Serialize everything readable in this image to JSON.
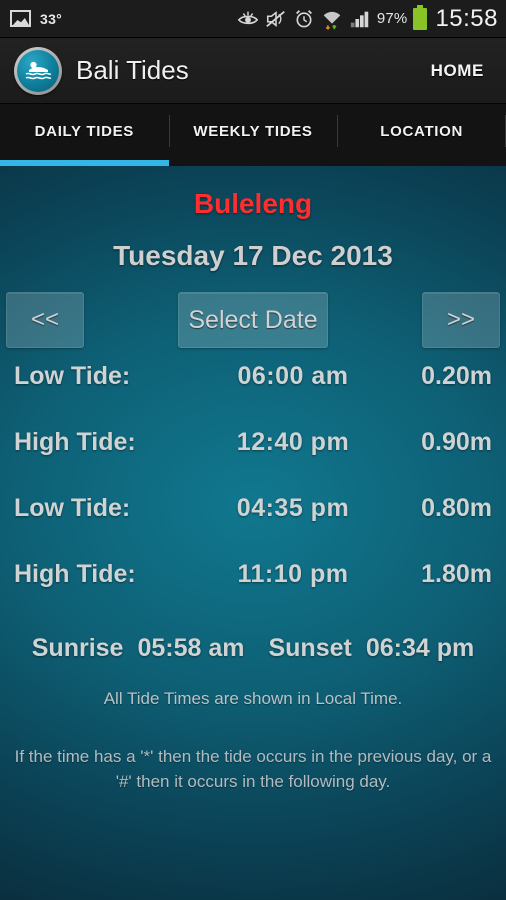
{
  "status_bar": {
    "gallery_icon": "gallery-icon",
    "temperature": "33°",
    "eye_icon": "eye-icon",
    "mute_icon": "mute-icon",
    "alarm_icon": "alarm-icon",
    "wifi_icon": "wifi-icon",
    "signal_icon": "signal-icon",
    "battery_percent": "97%",
    "battery_icon": "battery-icon",
    "clock": "15:58",
    "battery_color": "#8ac326"
  },
  "action_bar": {
    "logo_icon": "swimmer-logo-icon",
    "title": "Bali Tides",
    "home_label": "HOME"
  },
  "tabs": [
    {
      "label": "DAILY TIDES",
      "selected": true
    },
    {
      "label": "WEEKLY TIDES",
      "selected": false
    },
    {
      "label": "LOCATION",
      "selected": false
    }
  ],
  "tabs_accent_color": "#33b5e5",
  "main": {
    "location": "Buleleng",
    "location_color": "#ff2d2d",
    "date": "Tuesday 17 Dec 2013",
    "buttons": {
      "prev_label": "<<",
      "select_date_label": "Select Date",
      "next_label": ">>"
    },
    "tides": [
      {
        "label": "Low Tide:",
        "time": "06:00  am",
        "height": "0.20m"
      },
      {
        "label": "High Tide:",
        "time": "12:40  pm",
        "height": "0.90m"
      },
      {
        "label": "Low Tide:",
        "time": "04:35  pm",
        "height": "0.80m"
      },
      {
        "label": "High Tide:",
        "time": "11:10  pm",
        "height": "1.80m"
      }
    ],
    "sun": {
      "sunrise_label": "Sunrise",
      "sunrise_time": "05:58  am",
      "sunset_label": "Sunset",
      "sunset_time": "06:34  pm"
    },
    "note_local_time": "All Tide Times are shown in Local Time.",
    "note_symbols": "If the time has a '*' then the tide occurs in the previous day, or a '#' then it occurs in the following day."
  }
}
